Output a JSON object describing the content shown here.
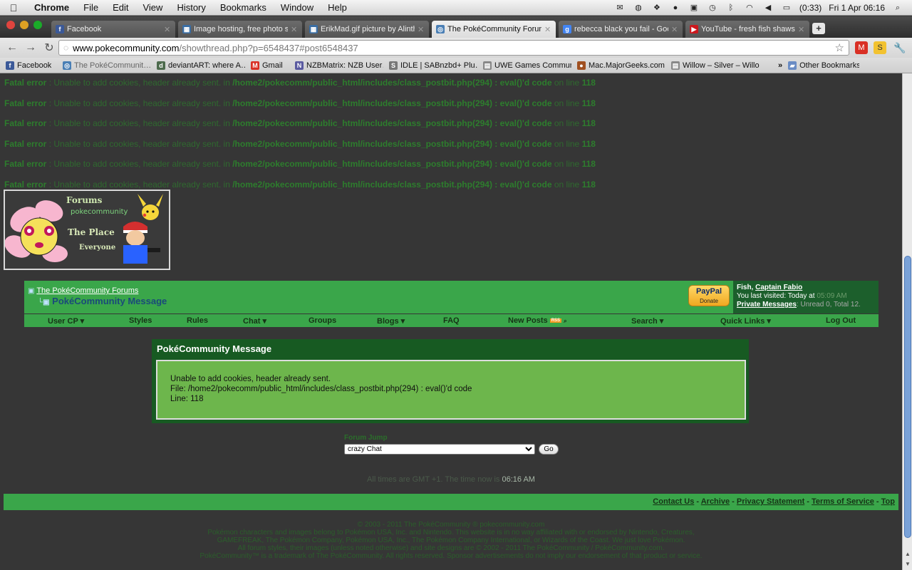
{
  "menubar": {
    "app": "Chrome",
    "items": [
      "File",
      "Edit",
      "View",
      "History",
      "Bookmarks",
      "Window",
      "Help"
    ],
    "battery": "(0:33)",
    "clock": "Fri 1 Apr  06:16"
  },
  "tabs": [
    {
      "label": "Facebook",
      "icon": "f",
      "color": "#3b5998"
    },
    {
      "label": "Image hosting, free photo sh",
      "icon": "▦",
      "color": "#3a6ea5"
    },
    {
      "label": "ErikMad.gif picture by Alinth",
      "icon": "▦",
      "color": "#3a6ea5"
    },
    {
      "label": "The PokéCommunity Forums",
      "icon": "◎",
      "color": "#4a7fb5"
    },
    {
      "label": "rebecca black you fail - Goog",
      "icon": "g",
      "color": "#4285f4"
    },
    {
      "label": "YouTube - fresh fish shawsh",
      "icon": "▶",
      "color": "#cc181e"
    }
  ],
  "omnibox": {
    "host": "www.pokecommunity.com",
    "path": "/showthread.php?p=6548437#post6548437"
  },
  "bookmarks": [
    {
      "label": "Facebook",
      "icon": "f",
      "color": "#3b5998"
    },
    {
      "label": "The PokéCommunit…",
      "icon": "◎",
      "color": "#4a7fb5"
    },
    {
      "label": "deviantART: where A…",
      "icon": "d",
      "color": "#4d6b4d"
    },
    {
      "label": "Gmail",
      "icon": "M",
      "color": "#d93025"
    },
    {
      "label": "NZBMatrix: NZB User…",
      "icon": "N",
      "color": "#5a5aa0"
    },
    {
      "label": "IDLE | SABnzbd+ Plu…",
      "icon": "S",
      "color": "#777"
    },
    {
      "label": "UWE Games Commun…",
      "icon": "▤",
      "color": "#888"
    },
    {
      "label": "Mac.MajorGeeks.com",
      "icon": "●",
      "color": "#a05020"
    },
    {
      "label": "Willow – Silver – Willo…",
      "icon": "▤",
      "color": "#888"
    },
    {
      "label": "Other Bookmarks",
      "icon": "▰",
      "color": "#6a8cc4"
    }
  ],
  "errors": [
    {
      "label": "Fatal error",
      "text": ": Unable to add cookies, header already sent. in",
      "file": "/home2/pokecomm/public_html/includes/class_postbit.php(294) : eval()'d code",
      "online": "on line",
      "line": "118"
    },
    {
      "label": "Fatal error",
      "text": ": Unable to add cookies, header already sent. in",
      "file": "/home2/pokecomm/public_html/includes/class_postbit.php(294) : eval()'d code",
      "online": "on line",
      "line": "118"
    },
    {
      "label": "Fatal error",
      "text": ": Unable to add cookies, header already sent. in",
      "file": "/home2/pokecomm/public_html/includes/class_postbit.php(294) : eval()'d code",
      "online": "on line",
      "line": "118"
    },
    {
      "label": "Fatal error",
      "text": ": Unable to add cookies, header already sent. in",
      "file": "/home2/pokecomm/public_html/includes/class_postbit.php(294) : eval()'d code",
      "online": "on line",
      "line": "118"
    },
    {
      "label": "Fatal error",
      "text": ": Unable to add cookies, header already sent. in",
      "file": "/home2/pokecomm/public_html/includes/class_postbit.php(294) : eval()'d code",
      "online": "on line",
      "line": "118"
    },
    {
      "label": "Fatal error",
      "text": ": Unable to add cookies, header already sent. in",
      "file": "/home2/pokecomm/public_html/includes/class_postbit.php(294) : eval()'d code",
      "online": "on line",
      "line": "118"
    }
  ],
  "logo": {
    "line1": "Forums",
    "line2": "pokecommunity",
    "line3": "The Place",
    "line4": "Everyone"
  },
  "breadcrumb": {
    "root": "The PokéCommunity Forums",
    "current": "PokéCommunity Message"
  },
  "paypal": {
    "label": "PayPal",
    "sub": "Donate"
  },
  "user": {
    "greeting": "Fish,",
    "name": "Captain Fabio",
    "last_visited_label": "You last visited: Today at",
    "last_visited_time": "05:09 AM",
    "pm_link": "Private Messages",
    "pm_counts": ": Unread 0, Total 12."
  },
  "navbar": [
    "User CP",
    "Styles",
    "Rules",
    "Chat",
    "Groups",
    "Blogs",
    "FAQ",
    "New Posts",
    "Search",
    "Quick Links",
    "Log Out"
  ],
  "message": {
    "title": "PokéCommunity Message",
    "line1": "Unable to add cookies, header already sent.",
    "line2": "File: /home2/pokecomm/public_html/includes/class_postbit.php(294) : eval()'d code",
    "line3": "Line: 118"
  },
  "forum_jump": {
    "label": "Forum Jump",
    "selected": "crazy Chat",
    "go": "Go"
  },
  "time": {
    "prefix": "All times are GMT +1. The time now is",
    "now": "06:16 AM"
  },
  "footer_links": [
    "Contact Us",
    "Archive",
    "Privacy Statement",
    "Terms of Service",
    "Top"
  ],
  "copyright": [
    "© 2003 - 2011 The PokéCommunity ® pokecommunity.com",
    "Pokémon characters and images belong to Pokémon USA, Inc. and Nintendo. This website is in no way affiliated with or endorsed by Nintendo, Creatures,",
    "GAMEFREAK, The Pokémon Company, Pokémon USA, Inc., The Pokémon Company International, or Wizards of the Coast. We just love Pokémon.",
    "All forum styles, their images (unless noted otherwise) and site designs are © 2002 - 2011 The PokéCommunity / PokéCommunity.com.",
    "PokéCommunity™ is a trademark of The PokéCommunity. All rights reserved. Sponsor advertisements do not imply our endorsement of that product or service."
  ]
}
